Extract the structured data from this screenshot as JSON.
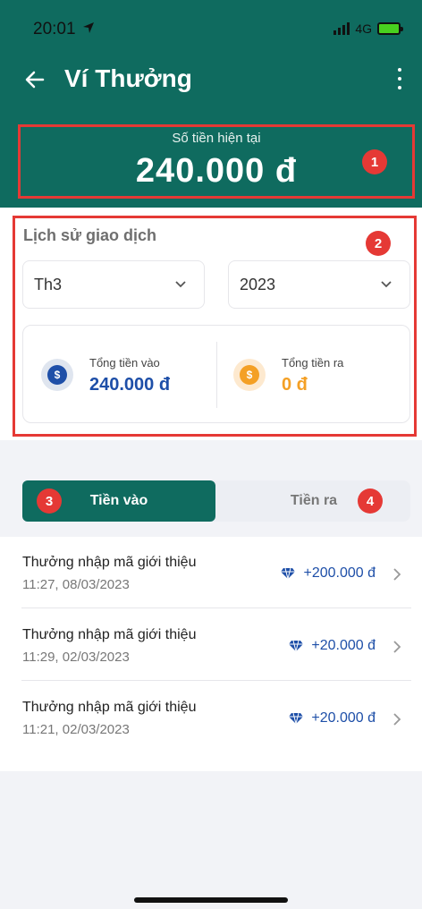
{
  "status_bar": {
    "time": "20:01",
    "network": "4G"
  },
  "header": {
    "title": "Ví Thưởng"
  },
  "balance": {
    "label": "Số tiền hiện tại",
    "value": "240.000 đ"
  },
  "badges": [
    "1",
    "2",
    "3",
    "4"
  ],
  "history": {
    "title": "Lịch sử giao dịch",
    "month_select": "Th3",
    "year_select": "2023",
    "total_in_label": "Tổng tiền vào",
    "total_in_value": "240.000 đ",
    "total_out_label": "Tổng tiền ra",
    "total_out_value": "0 đ"
  },
  "tabs": [
    {
      "label": "Tiền vào",
      "active": true
    },
    {
      "label": "Tiền ra",
      "active": false
    }
  ],
  "transactions": [
    {
      "title": "Thưởng nhập mã giới thiệu",
      "time": "11:27, 08/03/2023",
      "amount": "+200.000 đ"
    },
    {
      "title": "Thưởng nhập mã giới thiệu",
      "time": "11:29, 02/03/2023",
      "amount": "+20.000 đ"
    },
    {
      "title": "Thưởng nhập mã giới thiệu",
      "time": "11:21, 02/03/2023",
      "amount": "+20.000 đ"
    }
  ],
  "colors": {
    "brand": "#0f6b5f",
    "highlight": "#e53935",
    "in": "#1e4fa8",
    "out": "#f4a025"
  }
}
